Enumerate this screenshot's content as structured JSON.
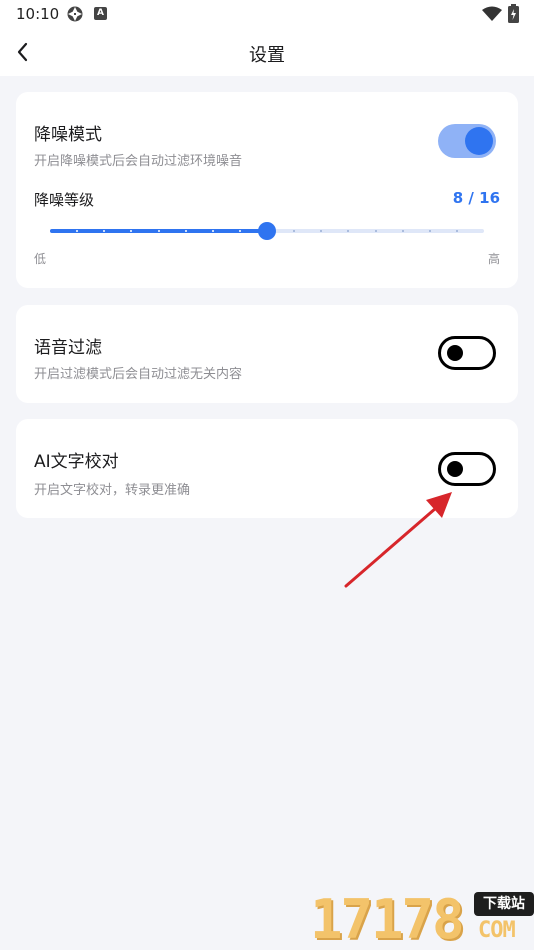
{
  "status_bar": {
    "time": "10:10",
    "notification_badge": "A"
  },
  "nav": {
    "title": "设置"
  },
  "noise_reduction": {
    "title": "降噪模式",
    "subtitle": "开启降噪模式后会自动过滤环境噪音",
    "enabled": true,
    "level_label": "降噪等级",
    "level_value": "8 / 16",
    "level": 8,
    "level_max": 16,
    "low_label": "低",
    "high_label": "高"
  },
  "voice_filter": {
    "title": "语音过滤",
    "subtitle": "开启过滤模式后会自动过滤无关内容",
    "enabled": false
  },
  "ai_proofread": {
    "title": "AI文字校对",
    "subtitle": "开启文字校对，转录更准确",
    "enabled": false
  },
  "watermark": {
    "digits": "17178",
    "badge": "下载站",
    "domain": "COM"
  },
  "colors": {
    "accent": "#2f74f0",
    "toggle_on_track": "#8fb2f6",
    "background": "#f4f5f9",
    "card": "#ffffff",
    "annotation_arrow": "#d7262b"
  }
}
